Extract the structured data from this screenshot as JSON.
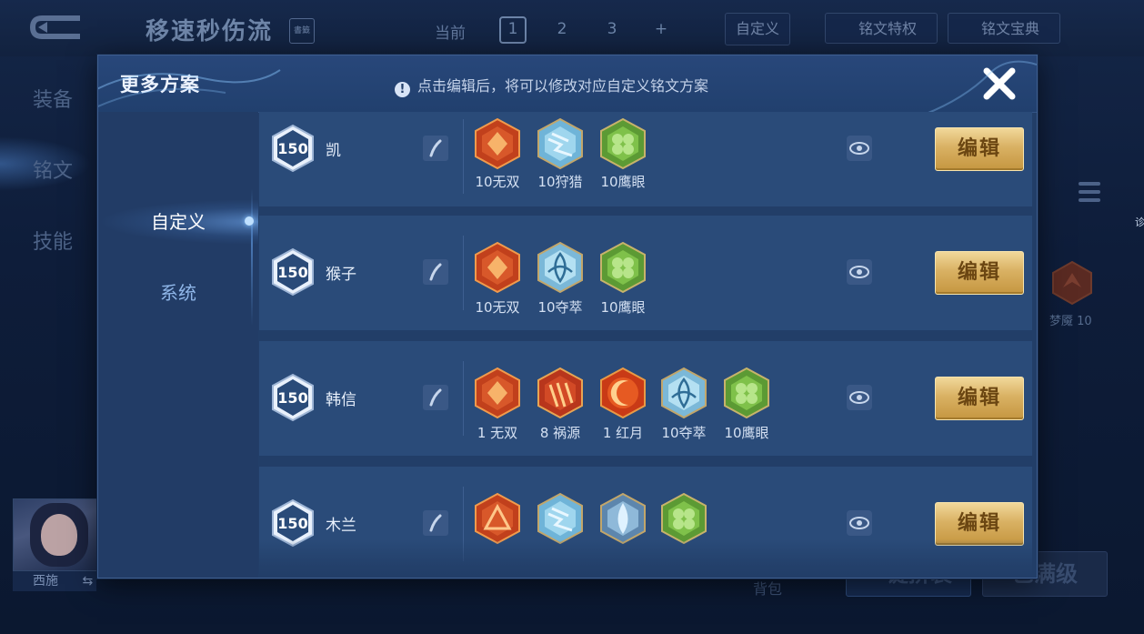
{
  "background": {
    "title": "移速秒伤流",
    "title_icon_text": "書籤",
    "current_label": "当前",
    "slots": [
      "1",
      "2",
      "3",
      "+"
    ],
    "custom_btn": "自定义",
    "privilege_btn": "铭文特权",
    "codex_btn": "铭文宝典",
    "side_tabs": [
      "装备",
      "铭文",
      "技能"
    ],
    "hero_name": "西施",
    "swap_icon": "⇆",
    "bag_label": "背包",
    "btn_assemble": "一键拼装",
    "btn_maxed": "已满级",
    "right_rune_label": "梦魇 10",
    "edge_text": "诊"
  },
  "modal": {
    "title": "更多方案",
    "tip": "点击编辑后，将可以修改对应自定义铭文方案",
    "tabs": [
      "自定义",
      "系统"
    ],
    "active_tab": "自定义",
    "edit_label": "编辑",
    "plans": [
      {
        "level": "150",
        "name": "凯",
        "runes": [
          {
            "icon": "wushuang-rune-icon",
            "label": "10无双"
          },
          {
            "icon": "shoulie-rune-icon",
            "label": "10狩猎"
          },
          {
            "icon": "yingyan-rune-icon",
            "label": "10鹰眼"
          }
        ]
      },
      {
        "level": "150",
        "name": "猴子",
        "runes": [
          {
            "icon": "wushuang-rune-icon",
            "label": "10无双"
          },
          {
            "icon": "duocui-rune-icon",
            "label": "10夺萃"
          },
          {
            "icon": "yingyan-rune-icon",
            "label": "10鹰眼"
          }
        ]
      },
      {
        "level": "150",
        "name": "韩信",
        "runes": [
          {
            "icon": "wushuang-rune-icon",
            "label": "1 无双"
          },
          {
            "icon": "huoyuan-rune-icon",
            "label": "8 祸源"
          },
          {
            "icon": "hongyue-rune-icon",
            "label": "1 红月"
          },
          {
            "icon": "duocui-rune-icon",
            "label": "10夺萃"
          },
          {
            "icon": "yingyan-rune-icon",
            "label": "10鹰眼"
          }
        ]
      },
      {
        "level": "150",
        "name": "木兰",
        "runes": [
          {
            "icon": "red-triangle-rune-icon",
            "label": ""
          },
          {
            "icon": "shoulie-rune-icon",
            "label": ""
          },
          {
            "icon": "blue-drop-rune-icon",
            "label": ""
          },
          {
            "icon": "yingyan-rune-icon",
            "label": ""
          }
        ]
      }
    ]
  }
}
